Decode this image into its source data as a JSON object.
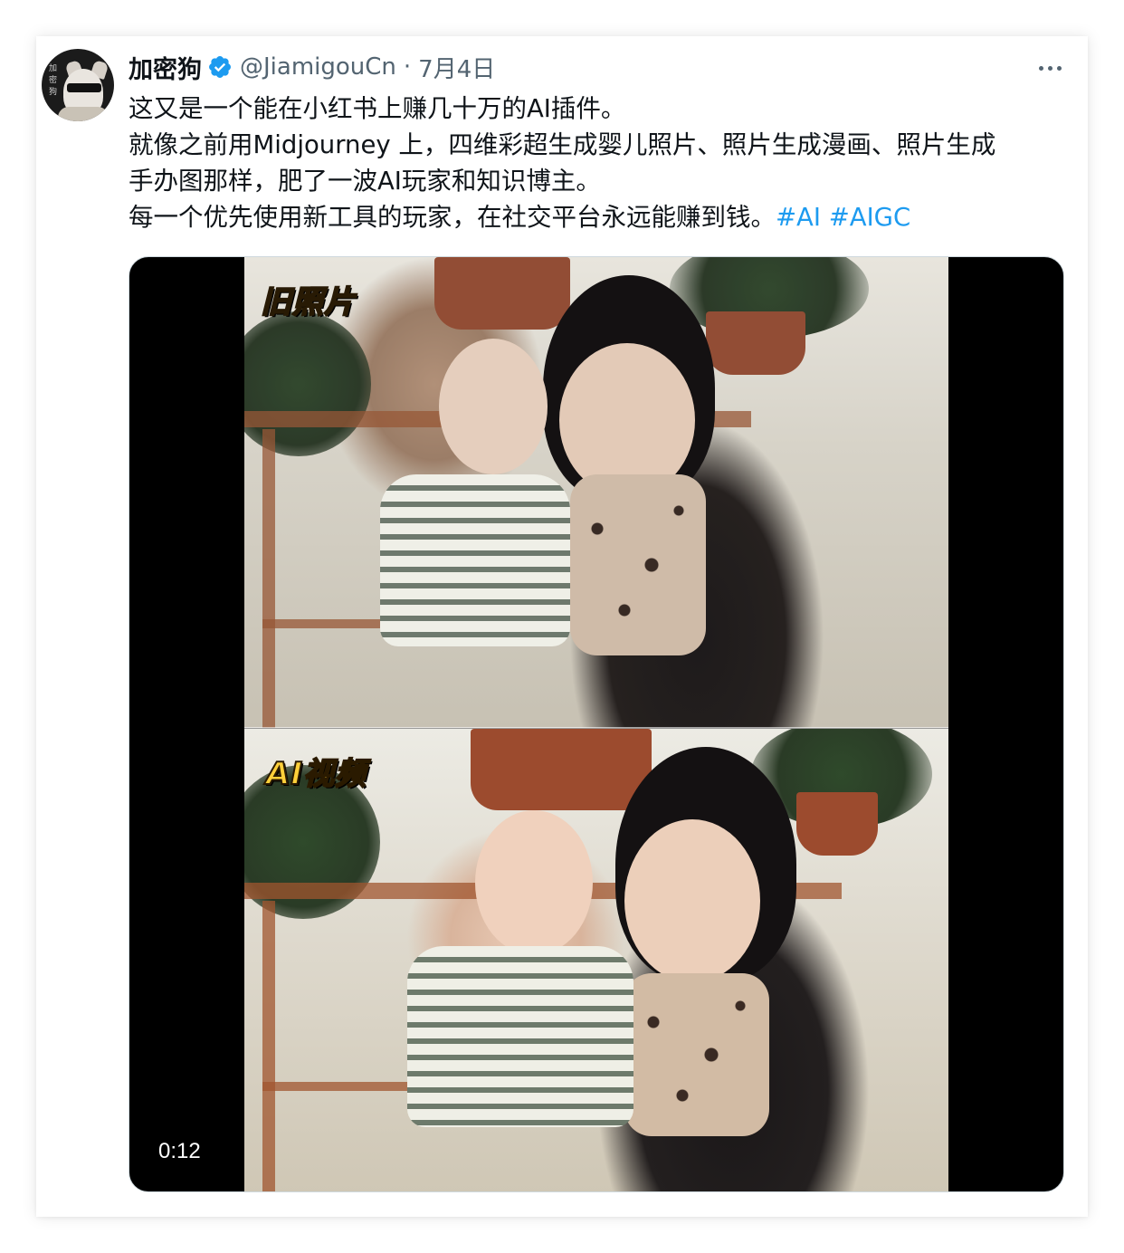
{
  "tweet": {
    "author_name": "加密狗",
    "handle": "@JiamigouCn",
    "separator": "·",
    "date": "7月4日",
    "avatar_text": "加密狗",
    "text_lines": [
      "这又是一个能在小红书上赚几十万的AI插件。",
      "就像之前用Midjourney 上，四维彩超生成婴儿照片、照片生成漫画、照片生成",
      "手办图那样，肥了一波AI玩家和知识博主。",
      "每一个优先使用新工具的玩家，在社交平台永远能赚到钱。"
    ],
    "hashtags": [
      "#AI",
      "#AIGC"
    ]
  },
  "media": {
    "top_label": "旧照片",
    "bottom_label": "AI视频",
    "duration": "0:12"
  },
  "icons": {
    "verified": "verified-badge-icon",
    "more": "more-options-icon"
  },
  "colors": {
    "accent": "#1d9bf0",
    "secondary_text": "#536471",
    "label_yellow": "#ffd03a"
  }
}
